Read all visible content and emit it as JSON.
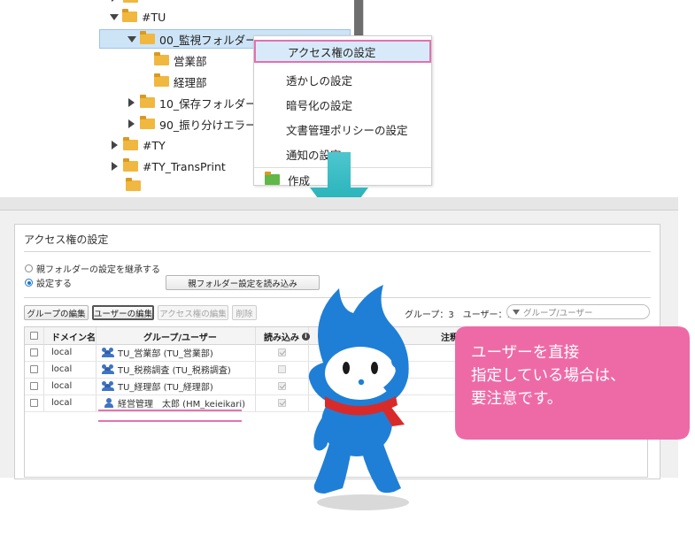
{
  "tree": {
    "items": [
      {
        "label": "#TU",
        "expanded": true,
        "selected": false
      },
      {
        "label": "00_監視フォルダー",
        "expanded": true,
        "selected": true
      },
      {
        "label": "営業部",
        "expanded": false,
        "selected": false
      },
      {
        "label": "経理部",
        "expanded": false,
        "selected": false
      },
      {
        "label": "10_保存フォルダー",
        "expanded": false,
        "selected": false
      },
      {
        "label": "90_振り分けエラー",
        "expanded": false,
        "selected": false
      },
      {
        "label": "#TY",
        "expanded": false,
        "selected": false
      },
      {
        "label": "#TY_TransPrint",
        "expanded": false,
        "selected": false
      }
    ]
  },
  "context_menu": {
    "items": [
      {
        "label": "アクセス権の設定",
        "highlighted": true
      },
      {
        "label": "透かしの設定",
        "highlighted": false
      },
      {
        "label": "暗号化の設定",
        "highlighted": false
      },
      {
        "label": "文書管理ポリシーの設定",
        "highlighted": false
      },
      {
        "label": "通知の設定",
        "highlighted": false
      },
      {
        "label": "作成",
        "highlighted": false
      }
    ],
    "highlight_color": "#e072b0"
  },
  "dialog": {
    "title": "アクセス権の設定",
    "radio_inherit": "親フォルダーの設定を継承する",
    "radio_set": "設定する",
    "load_parent_button": "親フォルダー設定を読み込み",
    "toolbar": {
      "edit_group": "グループの編集",
      "edit_user": "ユーザーの編集",
      "edit_access": "アクセス権の編集",
      "delete": "削除"
    },
    "counts": "グループ：3　ユーザー：1",
    "filter_placeholder": "グループ/ユーザー",
    "table": {
      "headers": {
        "domain": "ドメイン名",
        "group_user": "グループ/ユーザー",
        "read": "読み込み",
        "note": "注釈"
      },
      "rows": [
        {
          "domain": "local",
          "name": "TU_営業部 (TU_営業部)",
          "type": "group",
          "read": true
        },
        {
          "domain": "local",
          "name": "TU_税務調査 (TU_税務調査)",
          "type": "group",
          "read": false
        },
        {
          "domain": "local",
          "name": "TU_経理部 (TU_経理部)",
          "type": "group",
          "read": true
        },
        {
          "domain": "local",
          "name": "経営管理　太郎 (HM_keieikari)",
          "type": "user",
          "read": true
        }
      ]
    }
  },
  "callout": {
    "line1": "ユーザーを直接",
    "line2": "指定している場合は、",
    "line3": "要注意です。",
    "color": "#ee6aa7"
  },
  "colors": {
    "arrow": "#1fb3b8",
    "mascot_blue": "#1f7fd6",
    "scarf": "#d92a2a"
  }
}
